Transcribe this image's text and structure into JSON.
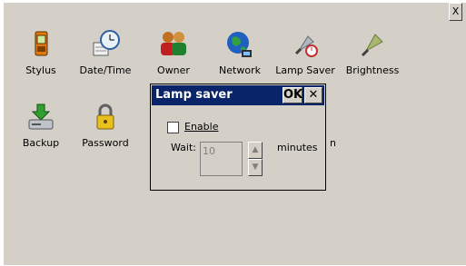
{
  "window": {
    "close_label": "X"
  },
  "icons": [
    {
      "id": "stylus",
      "label": "Stylus",
      "icon": "stylus-icon"
    },
    {
      "id": "datetime",
      "label": "Date/Time",
      "icon": "clock-icon"
    },
    {
      "id": "owner",
      "label": "Owner",
      "icon": "owner-icon"
    },
    {
      "id": "network",
      "label": "Network",
      "icon": "globe-icon"
    },
    {
      "id": "lampsaver",
      "label": "Lamp Saver",
      "icon": "lamp-icon"
    },
    {
      "id": "brightness",
      "label": "Brightness",
      "icon": "bulb-icon"
    },
    {
      "id": "backup",
      "label": "Backup",
      "icon": "backup-icon"
    },
    {
      "id": "password",
      "label": "Password",
      "icon": "lock-icon"
    }
  ],
  "hidden_label_fragment": "n",
  "dialog": {
    "title": "Lamp saver",
    "ok_label": "OK",
    "close_label": "✕",
    "enable_label": "Enable",
    "enable_checked": false,
    "wait_label": "Wait:",
    "wait_value": "10",
    "minutes_label": "minutes",
    "spin_up": "▲",
    "spin_down": "▼"
  }
}
